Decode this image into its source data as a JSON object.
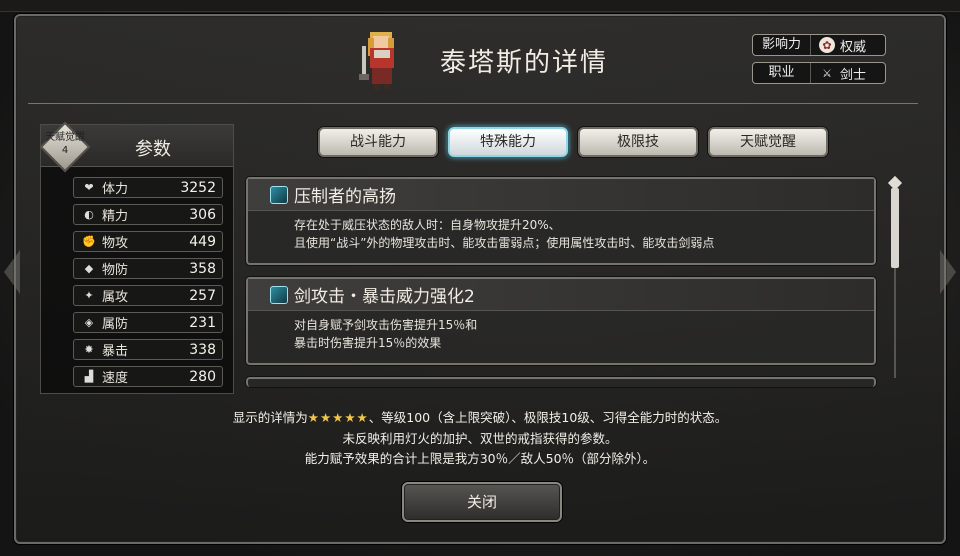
{
  "title": "泰塔斯的详情",
  "info": {
    "influence_label": "影响力",
    "influence_value": "权威",
    "job_label": "职业",
    "job_value": "剑士"
  },
  "stats": {
    "title": "参数",
    "badge_line1": "天赋觉醒",
    "badge_line2": "4",
    "items": [
      {
        "icon": "heart-icon",
        "label": "体力",
        "value": "3252"
      },
      {
        "icon": "spirit-icon",
        "label": "精力",
        "value": "306"
      },
      {
        "icon": "fist-icon",
        "label": "物攻",
        "value": "449"
      },
      {
        "icon": "shield-icon",
        "label": "物防",
        "value": "358"
      },
      {
        "icon": "magic-attack-icon",
        "label": "属攻",
        "value": "257"
      },
      {
        "icon": "magic-shield-icon",
        "label": "属防",
        "value": "231"
      },
      {
        "icon": "critical-icon",
        "label": "暴击",
        "value": "338"
      },
      {
        "icon": "boot-icon",
        "label": "速度",
        "value": "280"
      }
    ]
  },
  "tabs": [
    {
      "label": "战斗能力",
      "active": false
    },
    {
      "label": "特殊能力",
      "active": true
    },
    {
      "label": "极限技",
      "active": false
    },
    {
      "label": "天赋觉醒",
      "active": false
    }
  ],
  "skills": [
    {
      "name": "压制者的高扬",
      "line1": "存在处于威压状态的敌人时：自身物攻提升20%、",
      "line2": "且使用“战斗”外的物理攻击时、能攻击雷弱点；使用属性攻击时、能攻击剑弱点"
    },
    {
      "name": "剑攻击・暴击威力强化2",
      "line1": "对自身赋予剑攻击伤害提升15％和",
      "line2": "暴击时伤害提升15％的效果"
    }
  ],
  "footer": {
    "line1_prefix": "显示的详情为",
    "stars": "★★★★★",
    "line1_suffix": "、等级100（含上限突破）、极限技10级、习得全能力时的状态。",
    "line2": "未反映利用灯火的加护、双世的戒指获得的参数。",
    "line3": "能力赋予效果的合计上限是我方30％／敌人50％（部分除外）。"
  },
  "close_label": "关闭",
  "colors": {
    "accent_tab": "#8fd6e8",
    "star": "#f2c447"
  }
}
